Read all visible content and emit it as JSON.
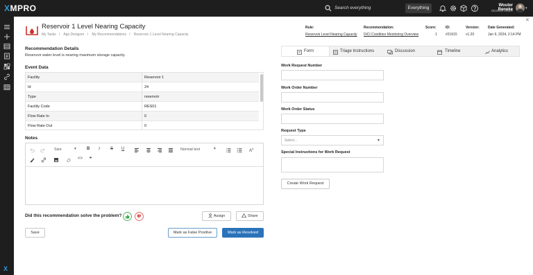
{
  "app": {
    "brand_x": "X",
    "brand_rest": "MPRO"
  },
  "topbar": {
    "search_placeholder": "Search everything",
    "scope": "Everything",
    "user": {
      "name": "Wouter Beneke",
      "role": "DESIGN USER"
    }
  },
  "page": {
    "title": "Reservoir 1 Level Nearing Capacity",
    "breadcrumbs": [
      "My Tasks",
      "App Designer",
      "My Recommendations",
      "Reservoir 1 Level Nearing Capacity"
    ]
  },
  "meta": {
    "rule_label": "Rule:",
    "rule_value": "Reservoir Level Nearing Capacity",
    "recommendation_label": "Recommendation:",
    "recommendation_value": "DiCI Condition Monitoring Overview",
    "score_label": "Score:",
    "score_value": "1",
    "id_label": "ID:",
    "id_value": "#21615",
    "version_label": "Version:",
    "version_value": "v1.20",
    "generated_label": "Date Generated:",
    "generated_value": "Jan 9, 2024, 2:14 PM"
  },
  "details": {
    "heading": "Recommendation Details",
    "description": "Reservoir water level is nearing maximum storage capacity."
  },
  "event_data": {
    "heading": "Event Data",
    "rows": [
      {
        "key": "Facility",
        "value": "Reservoir 1"
      },
      {
        "key": "Id",
        "value": "24"
      },
      {
        "key": "Type",
        "value": "reservoir"
      },
      {
        "key": "Facility Code",
        "value": "RES01"
      },
      {
        "key": "Flow Rate In",
        "value": "0"
      },
      {
        "key": "Flow Rate Out",
        "value": "0"
      }
    ]
  },
  "notes": {
    "heading": "Notes",
    "size_select": "Size",
    "style_select": "Normal text"
  },
  "feedback": {
    "question": "Did this recommendation solve the problem?",
    "assign": "Assign",
    "share": "Share"
  },
  "actions": {
    "save": "Save",
    "false_positive": "Mark as False Positive",
    "resolved": "Mark as Resolved"
  },
  "tabs": [
    {
      "label": "Form",
      "icon": "form-icon"
    },
    {
      "label": "Triage Instructions",
      "icon": "list-icon"
    },
    {
      "label": "Discussion",
      "icon": "discussion-icon"
    },
    {
      "label": "Timeline",
      "icon": "calendar-icon"
    },
    {
      "label": "Analytics",
      "icon": "analytics-icon"
    }
  ],
  "form": {
    "work_request_number": "Work Request Number",
    "work_order_number": "Work Order Number",
    "work_order_status": "Work Order Status",
    "request_type": "Request Type",
    "request_type_placeholder": "Select...",
    "special_instructions": "Special Instructions for Work Request",
    "create_button": "Create Work Request"
  },
  "colors": {
    "accent": "#2b73b9",
    "brand_x": "#2f9bd8",
    "topbar": "#1e1e1e",
    "thumb_up": "#3aa54a",
    "thumb_down": "#d9534f"
  }
}
